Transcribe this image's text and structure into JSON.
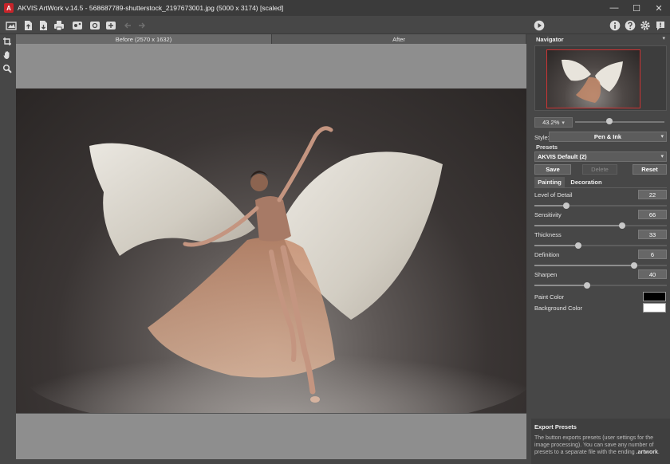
{
  "window": {
    "title": "AKVIS ArtWork v.14.5 - 568687789-shutterstock_2197673001.jpg (5000 x 3174) [scaled]",
    "logo_letter": "A",
    "minimize_glyph": "—",
    "maximize_glyph": "☐",
    "close_glyph": "✕"
  },
  "toolbar": {
    "left_icons": [
      "home-icon",
      "open-file-icon",
      "save-file-icon",
      "print-icon",
      "share-icon",
      "batch-icon",
      "preferences-icon",
      "undo-icon",
      "redo-icon"
    ],
    "right_icons": [
      "run-icon",
      "info-icon",
      "help-icon",
      "settings-icon",
      "notifications-icon"
    ]
  },
  "tools": [
    "crop-tool-icon",
    "hand-tool-icon",
    "zoom-tool-icon"
  ],
  "tabs": {
    "before": "Before (2570 x 1632)",
    "after": "After"
  },
  "navigator": {
    "title": "Navigator",
    "zoom": "43.2%",
    "zoom_arrow": "▾",
    "zoom_level": 0.38,
    "collapse_glyph": "▾"
  },
  "style": {
    "label": "Style:",
    "value": "Pen & Ink",
    "arrow": "▾"
  },
  "presets": {
    "label": "Presets",
    "value": "AKVIS Default (2)",
    "arrow": "▾",
    "save": "Save",
    "delete": "Delete",
    "reset": "Reset"
  },
  "settings_tabs": {
    "painting": "Painting",
    "decoration": "Decoration"
  },
  "params": [
    {
      "label": "Level of Detail",
      "value": "22",
      "level": 0.24
    },
    {
      "label": "Sensitivity",
      "value": "66",
      "level": 0.66
    },
    {
      "label": "Thickness",
      "value": "33",
      "level": 0.33
    },
    {
      "label": "Definition",
      "value": "6",
      "level": 0.75
    },
    {
      "label": "Sharpen",
      "value": "40",
      "level": 0.4
    }
  ],
  "colors": {
    "paint_label": "Paint Color",
    "paint": "#000000",
    "background_label": "Background Color",
    "background": "#ffffff",
    "accent_red": "#c8242a"
  },
  "help": {
    "title": "Export Presets",
    "text": "The button exports presets (user settings for the image processing). You can save any number of presets to a separate file with the ending ",
    "ext": ".artwork",
    "end": "."
  }
}
